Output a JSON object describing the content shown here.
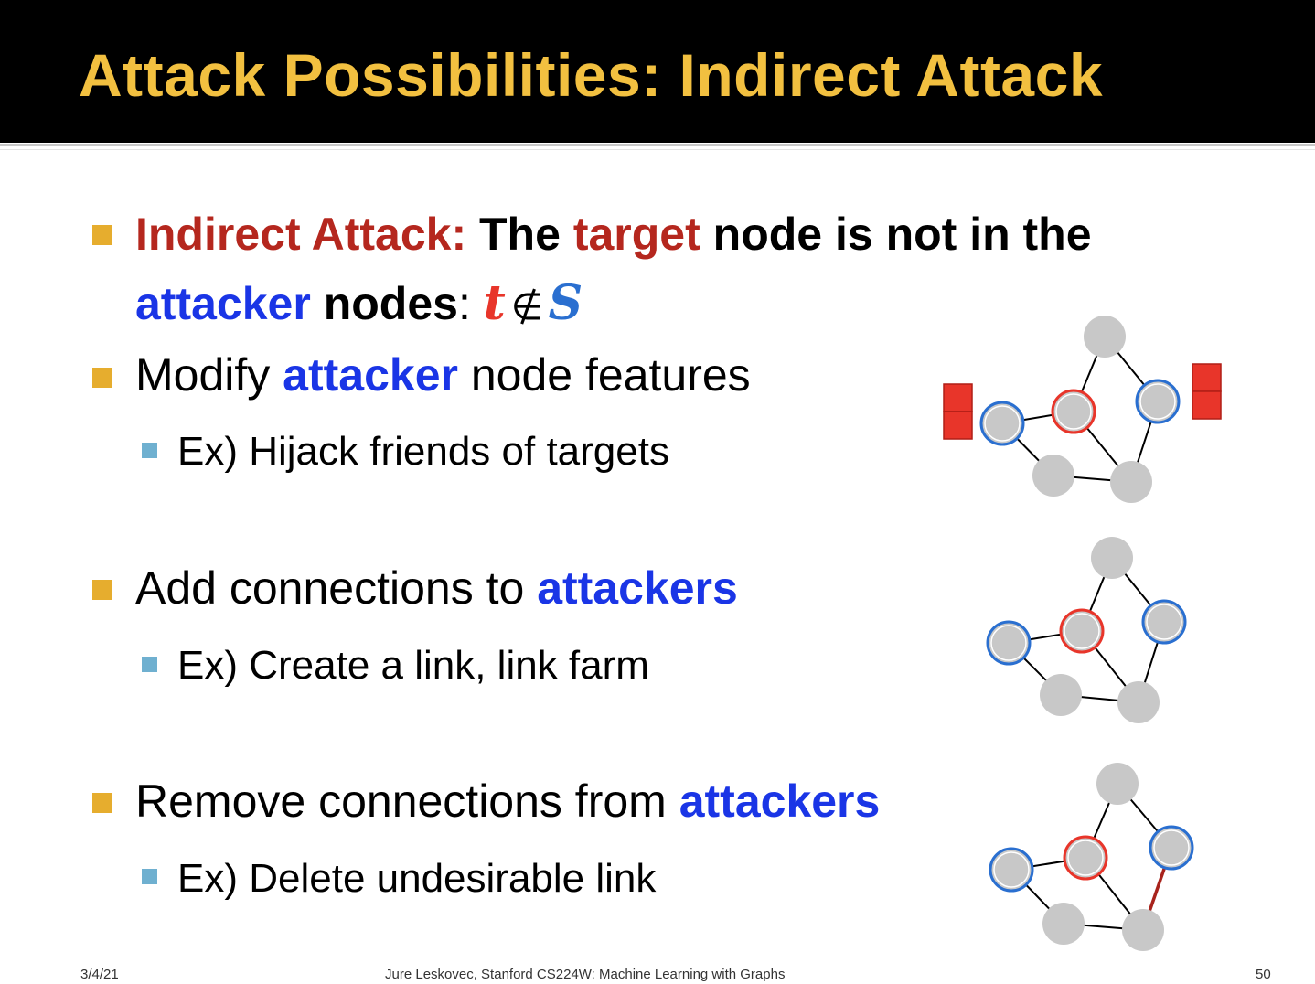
{
  "title": "Attack Possibilities: Indirect Attack",
  "bullets": {
    "b1": {
      "label": "Indirect Attack:",
      "text1": "The",
      "target_word": "target",
      "text2": "node is not in the",
      "attacker_word": "attacker",
      "text3": "nodes",
      "colon": ":",
      "math_t": "t",
      "math_notin": "∉",
      "math_s": "S"
    },
    "b2": {
      "text1": "Modify",
      "attacker_word": "attacker",
      "text2": "node features",
      "sub": "Ex) Hijack friends of targets"
    },
    "b3": {
      "text1": "Add connections to",
      "attacker_word": "attackers",
      "sub": "Ex) Create a link, link farm"
    },
    "b4": {
      "text1": "Remove connections from",
      "attacker_word": "attackers",
      "sub": "Ex) Delete undesirable link"
    }
  },
  "footer": {
    "date": "3/4/21",
    "credit": "Jure Leskovec, Stanford CS224W: Machine Learning with Graphs",
    "page": "50"
  },
  "colors": {
    "title": "#f2c040",
    "label_red": "#b5271e",
    "attacker_blue": "#1a35e6",
    "node_gray": "#c8c8c8",
    "target_ring": "#e8352a",
    "attacker_ring": "#2a6fd0",
    "feature_box": "#e8352a",
    "deleted_edge": "#a8231c"
  }
}
